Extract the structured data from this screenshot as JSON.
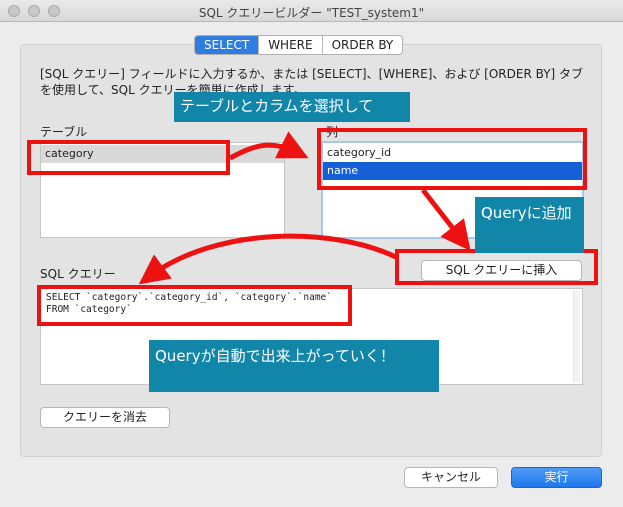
{
  "window": {
    "title": "SQL クエリービルダー \"TEST_system1\""
  },
  "tabs": [
    {
      "label": "SELECT",
      "active": true
    },
    {
      "label": "WHERE",
      "active": false
    },
    {
      "label": "ORDER BY",
      "active": false
    }
  ],
  "description": "[SQL クエリー] フィールドに入力するか、または [SELECT]、[WHERE]、および [ORDER BY] タブを使用して、SQL クエリーを簡単に作成します。",
  "tables": {
    "label": "テーブル",
    "items": [
      "category"
    ]
  },
  "columns": {
    "label": "列",
    "items": [
      "category_id",
      "name"
    ]
  },
  "sql": {
    "label": "SQL クエリー",
    "line1": "SELECT `category`.`category_id`, `category`.`name`",
    "line2": "FROM `category`"
  },
  "buttons": {
    "insert": "SQL クエリーに挿入",
    "clear": "クエリーを消去",
    "cancel": "キャンセル",
    "run": "実行"
  },
  "annotations": {
    "select": "テーブルとカラムを選択して",
    "add": "Queryに追加",
    "auto": "Queryが自動で出来上がっていく！"
  },
  "colors": {
    "accent": "#2f7de1",
    "selection": "#1560d6",
    "annotation_red": "#ee1111",
    "callout_bg": "#1286a9"
  }
}
